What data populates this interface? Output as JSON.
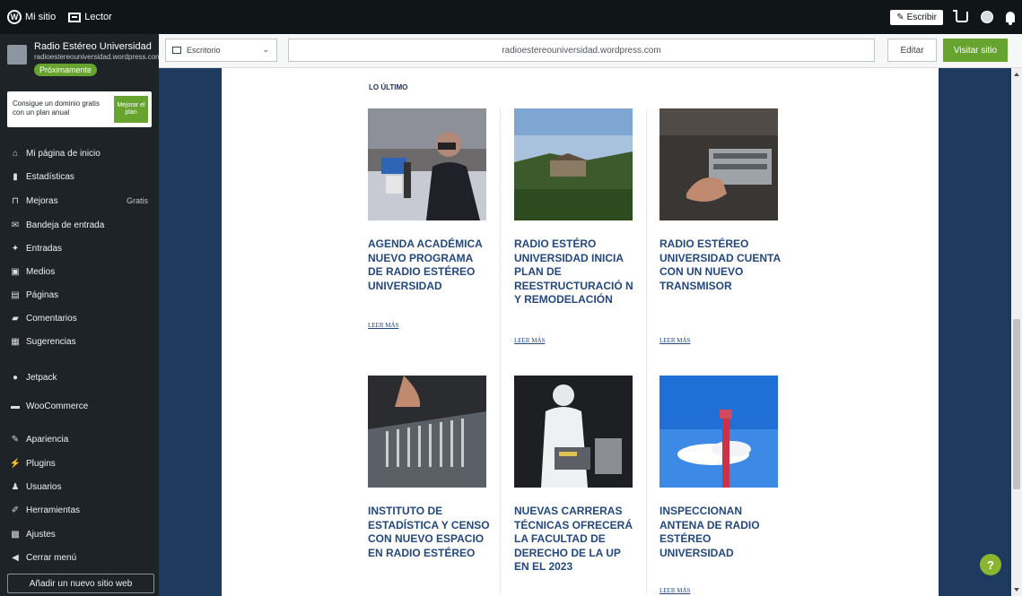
{
  "adminbar": {
    "my_site": "Mi sitio",
    "reader": "Lector",
    "write": "Escribir"
  },
  "sidebar": {
    "site_name": "Radio Estéreo Universidad",
    "site_url": "radioestereouniversidad.wordpress.com",
    "badge": "Próximamente",
    "promo_text": "Consigue un dominio gratis con un plan anual",
    "promo_button": "Mejorar el plan",
    "items": [
      {
        "label": "Mi página de inicio",
        "icon": "home-icon"
      },
      {
        "label": "Estadísticas",
        "icon": "stats-icon"
      },
      {
        "label": "Mejoras",
        "icon": "cart-icon",
        "badge": "Gratis"
      },
      {
        "label": "Bandeja de entrada",
        "icon": "inbox-icon"
      },
      {
        "label": "Entradas",
        "icon": "pin-icon"
      },
      {
        "label": "Medios",
        "icon": "media-icon"
      },
      {
        "label": "Páginas",
        "icon": "pages-icon"
      },
      {
        "label": "Comentarios",
        "icon": "comment-icon"
      },
      {
        "label": "Sugerencias",
        "icon": "feedback-icon"
      },
      {
        "label": "Jetpack",
        "icon": "jetpack-icon"
      },
      {
        "label": "WooCommerce",
        "icon": "woocommerce-icon"
      },
      {
        "label": "Apariencia",
        "icon": "brush-icon"
      },
      {
        "label": "Plugins",
        "icon": "plugin-icon"
      },
      {
        "label": "Usuarios",
        "icon": "users-icon"
      },
      {
        "label": "Herramientas",
        "icon": "wrench-icon"
      },
      {
        "label": "Ajustes",
        "icon": "settings-icon"
      },
      {
        "label": "Cerrar menú",
        "icon": "collapse-icon"
      }
    ],
    "add_site": "Añadir un nuevo sitio web"
  },
  "toolbar": {
    "device": "Escritorio",
    "url": "radioestereouniversidad.wordpress.com",
    "edit": "Editar",
    "visit": "Visitar sitio"
  },
  "preview": {
    "section_title": "LO ÚLTIMO",
    "read_more": "LEER MÁS",
    "posts": [
      {
        "title": "AGENDA ACADÉMICA NUEVO PROGRAMA DE RADIO ESTÉREO UNIVERSIDAD"
      },
      {
        "title": "RADIO ESTÉRO UNIVERSIDAD INICIA PLAN DE REESTRUCTURACIÓ N Y REMODELACIÓN"
      },
      {
        "title": "RADIO ESTÉREO UNIVERSIDAD CUENTA CON UN NUEVO TRANSMISOR"
      },
      {
        "title": "INSTITUTO DE ESTADÍSTICA Y CENSO CON NUEVO ESPACIO EN RADIO ESTÉREO"
      },
      {
        "title": "NUEVAS CARRERAS TÉCNICAS OFRECERÁ LA FACULTAD DE DERECHO DE LA UP EN EL 2023"
      },
      {
        "title": "INSPECCIONAN ANTENA DE RADIO ESTÉREO UNIVERSIDAD"
      }
    ]
  },
  "help": "?"
}
